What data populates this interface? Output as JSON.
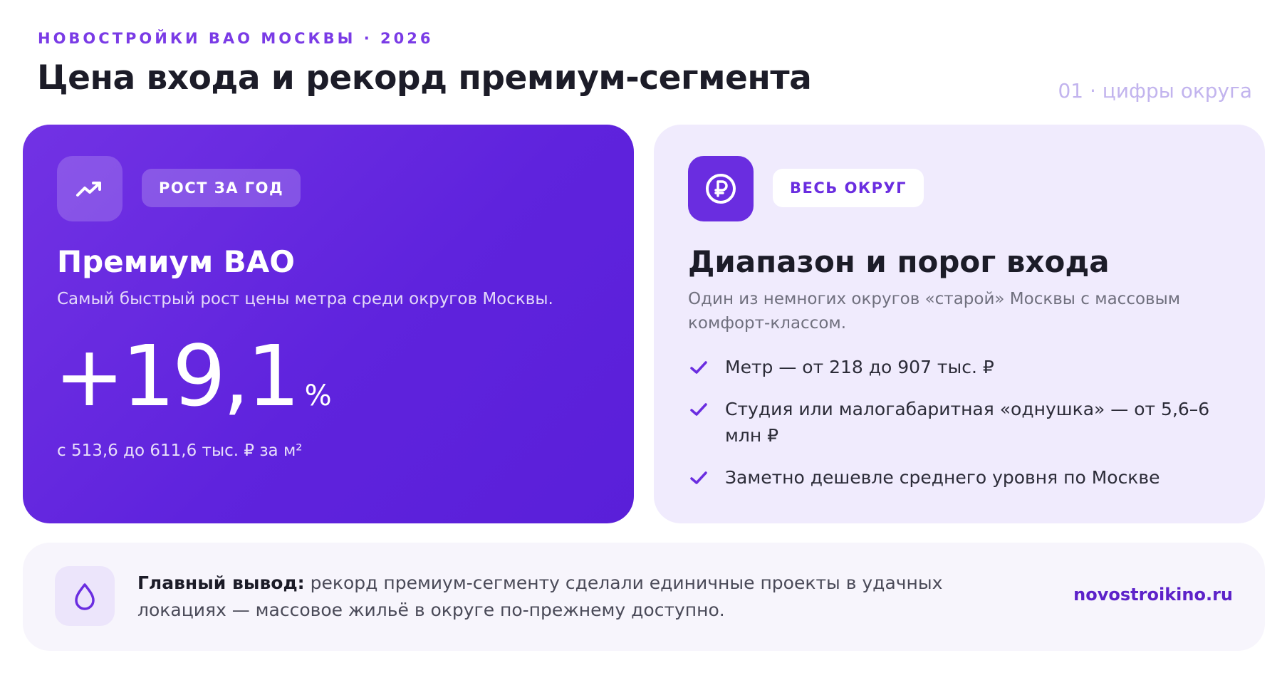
{
  "header": {
    "eyebrow": "НОВОСТРОЙКИ ВАО МОСКВЫ · 2026",
    "title": "Цена входа и рекорд премиум-сегмента",
    "page_index": "01 · цифры округа"
  },
  "left_card": {
    "icon": "trend-up-icon",
    "badge": "РОСТ ЗА ГОД",
    "heading": "Премиум ВАО",
    "subtitle": "Самый быстрый рост цены метра среди округов Москвы.",
    "big_value": "+19,1",
    "big_unit": "%",
    "range_note": "с 513,6 до 611,6 тыс. ₽ за м²"
  },
  "right_card": {
    "icon": "ruble-coin-icon",
    "badge": "ВЕСЬ ОКРУГ",
    "heading": "Диапазон и порог входа",
    "subtitle": "Один из немногих округов «старой» Москвы с массовым комфорт-классом.",
    "items": [
      "Метр — от 218 до 907 тыс. ₽",
      "Студия или малогабаритная «однушка» — от 5,6–6 млн ₽",
      "Заметно дешевле среднего уровня по Москве"
    ]
  },
  "footer": {
    "icon": "drop-icon",
    "lead": "Главный вывод:",
    "text": " рекорд премиум-сегменту сделали единичные проекты в удачных локациях — массовое жильё в округе по-прежнему доступно.",
    "brand": "novostroikino.ru"
  },
  "colors": {
    "accent": "#6a2de0",
    "left_card_bg": "#6328df",
    "right_card_bg": "#f0ebfd",
    "footer_bg": "#f7f5fc"
  }
}
